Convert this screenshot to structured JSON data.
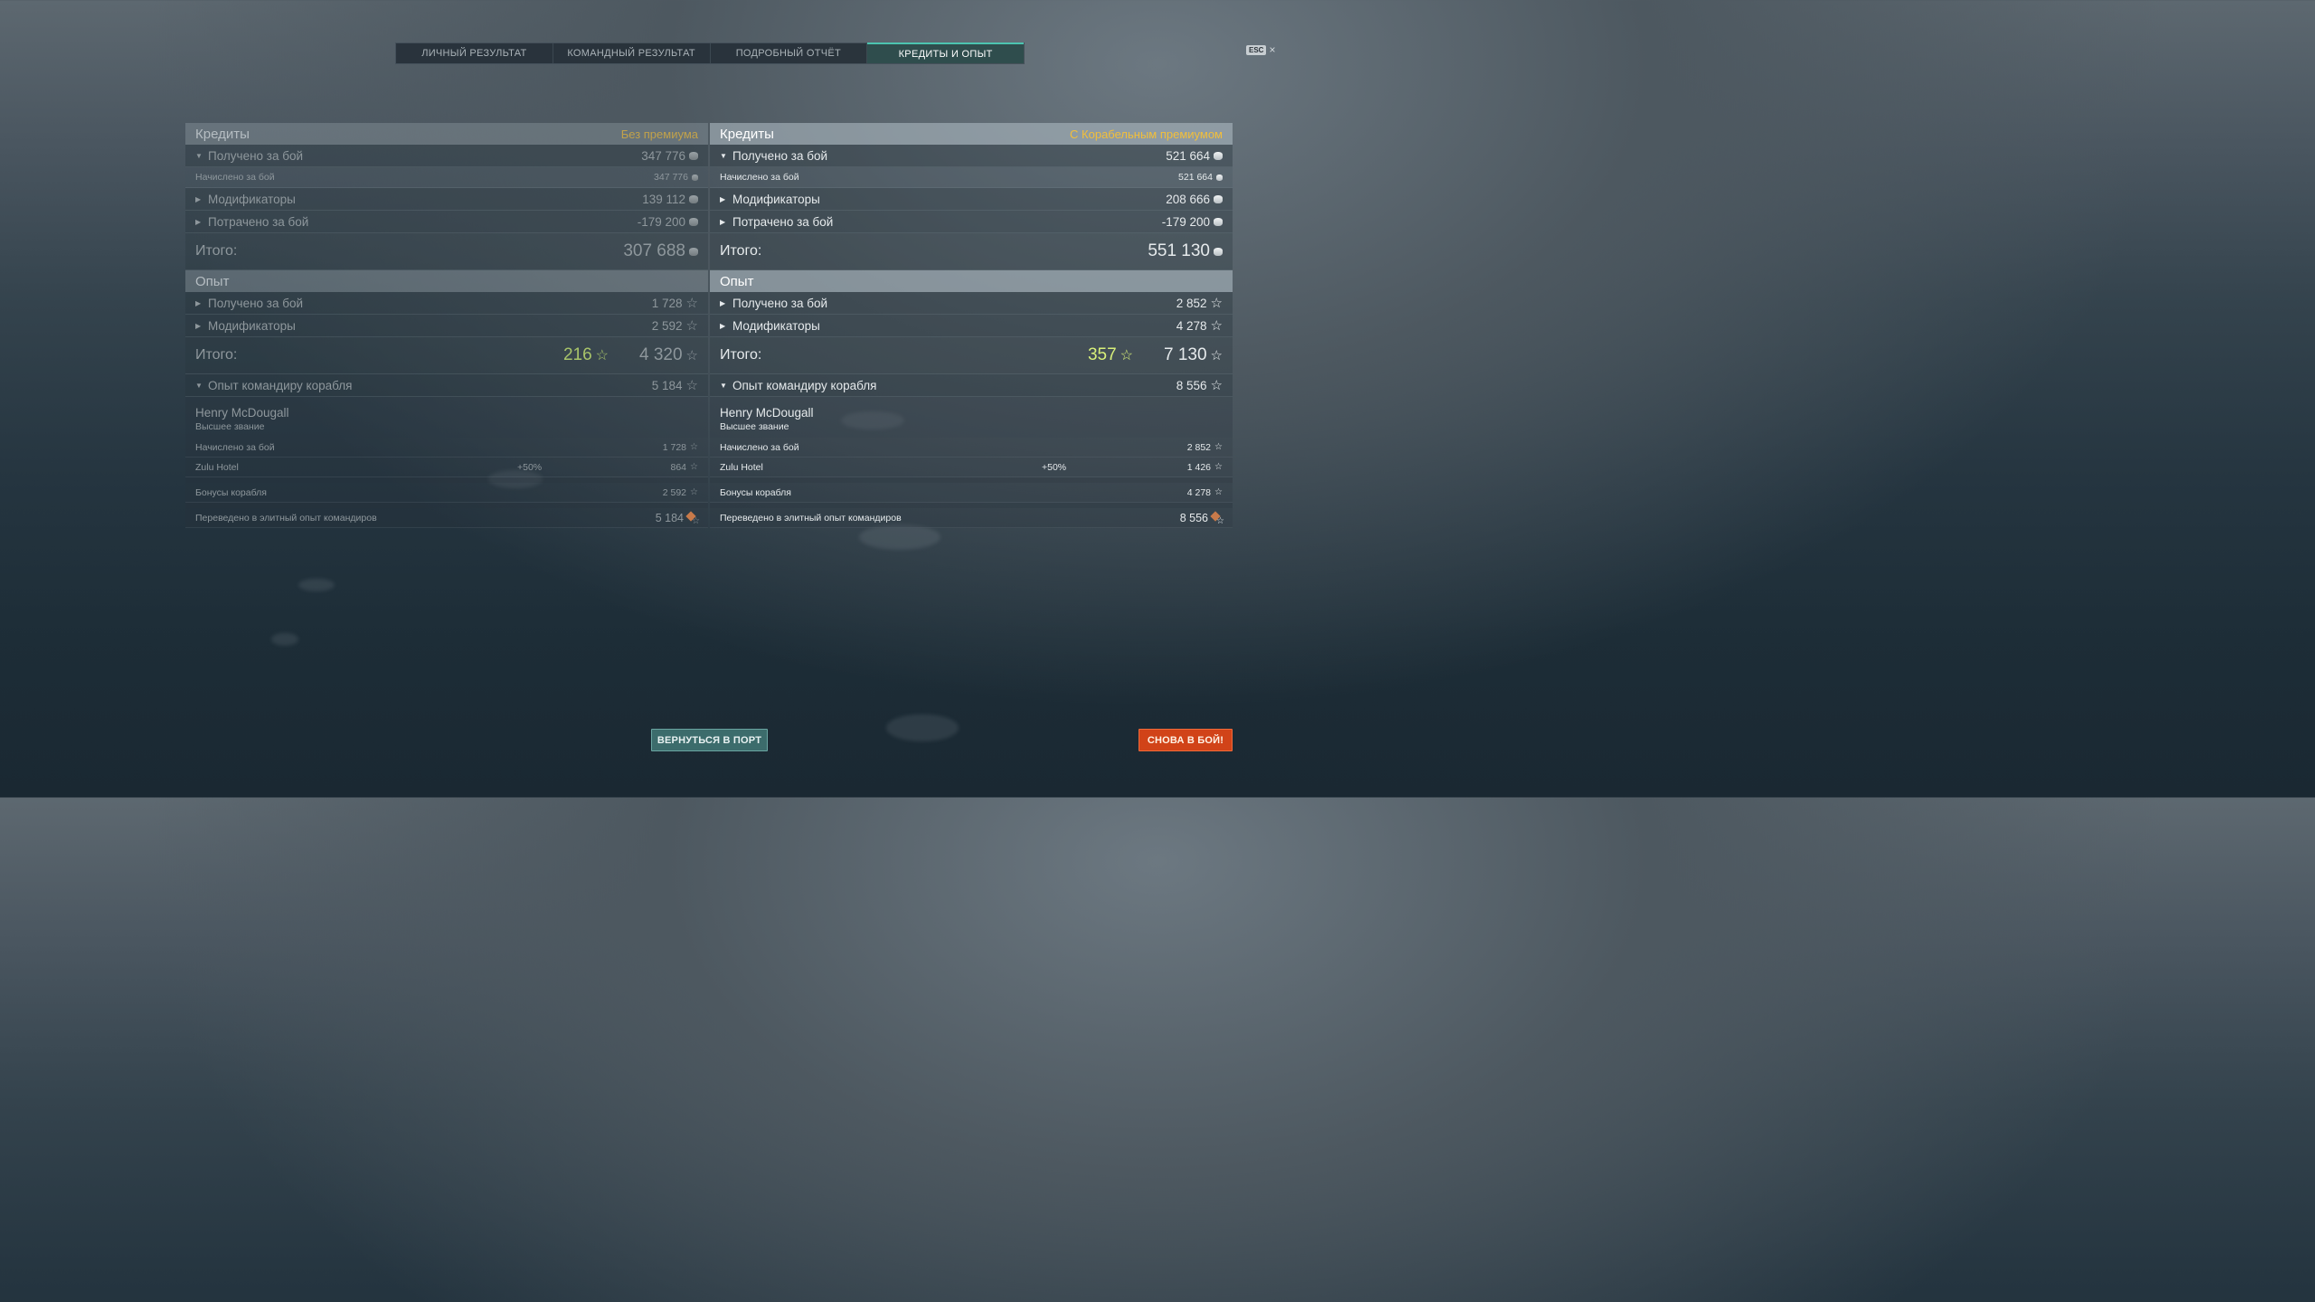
{
  "tabs": [
    {
      "label": "ЛИЧНЫЙ РЕЗУЛЬТАТ"
    },
    {
      "label": "КОМАНДНЫЙ РЕЗУЛЬТАТ"
    },
    {
      "label": "ПОДРОБНЫЙ ОТЧЁТ"
    },
    {
      "label": "КРЕДИТЫ И ОПЫТ",
      "active": true
    }
  ],
  "esc": {
    "key": "ESC",
    "close": "×"
  },
  "columns": {
    "left": {
      "credits_title": "Кредиты",
      "premium_label": "Без премиума",
      "earned_label": "Получено за бой",
      "earned_value": "347 776",
      "accrued_label": "Начислено за бой",
      "accrued_value": "347 776",
      "modifiers_label": "Модификаторы",
      "modifiers_value": "139 112",
      "spent_label": "Потрачено за бой",
      "spent_value": "-179 200",
      "total_label": "Итого:",
      "total_value": "307 688",
      "exp_title": "Опыт",
      "exp_earned_label": "Получено за бой",
      "exp_earned_value": "1 728",
      "exp_modifiers_label": "Модификаторы",
      "exp_modifiers_value": "2 592",
      "exp_total_label": "Итого:",
      "exp_free_value": "216",
      "exp_total_value": "4 320",
      "commander_label": "Опыт командиру корабля",
      "commander_value": "5 184",
      "commander_name": "Henry McDougall",
      "commander_rank": "Высшее звание",
      "cmd_accrued_label": "Начислено за бой",
      "cmd_accrued_value": "1 728",
      "cmd_signal_label": "Zulu Hotel",
      "cmd_signal_bonus": "+50%",
      "cmd_signal_value": "864",
      "cmd_ship_bonus_label": "Бонусы корабля",
      "cmd_ship_bonus_value": "2 592",
      "cmd_elite_label": "Переведено в элитный опыт командиров",
      "cmd_elite_value": "5 184"
    },
    "right": {
      "credits_title": "Кредиты",
      "premium_label": "С Корабельным премиумом",
      "earned_label": "Получено за бой",
      "earned_value": "521 664",
      "accrued_label": "Начислено за бой",
      "accrued_value": "521 664",
      "modifiers_label": "Модификаторы",
      "modifiers_value": "208 666",
      "spent_label": "Потрачено за бой",
      "spent_value": "-179 200",
      "total_label": "Итого:",
      "total_value": "551 130",
      "exp_title": "Опыт",
      "exp_earned_label": "Получено за бой",
      "exp_earned_value": "2 852",
      "exp_modifiers_label": "Модификаторы",
      "exp_modifiers_value": "4 278",
      "exp_total_label": "Итого:",
      "exp_free_value": "357",
      "exp_total_value": "7 130",
      "commander_label": "Опыт командиру корабля",
      "commander_value": "8 556",
      "commander_name": "Henry McDougall",
      "commander_rank": "Высшее звание",
      "cmd_accrued_label": "Начислено за бой",
      "cmd_accrued_value": "2 852",
      "cmd_signal_label": "Zulu Hotel",
      "cmd_signal_bonus": "+50%",
      "cmd_signal_value": "1 426",
      "cmd_ship_bonus_label": "Бонусы корабля",
      "cmd_ship_bonus_value": "4 278",
      "cmd_elite_label": "Переведено в элитный опыт командиров",
      "cmd_elite_value": "8 556"
    }
  },
  "buttons": {
    "port": "ВЕРНУТЬСЯ В ПОРТ",
    "battle": "СНОВА В БОЙ!"
  },
  "colors": {
    "tab_active_accent": "#4cc4b0",
    "premium_yellow": "#f2bf3a",
    "free_exp_green": "#d8f07a",
    "battle_button": "#d14318",
    "port_button": "#3c6c6c"
  },
  "icons": {
    "credit": "credit-coin-icon",
    "exp": "star-icon",
    "elite": "elite-commander-exp-icon"
  }
}
